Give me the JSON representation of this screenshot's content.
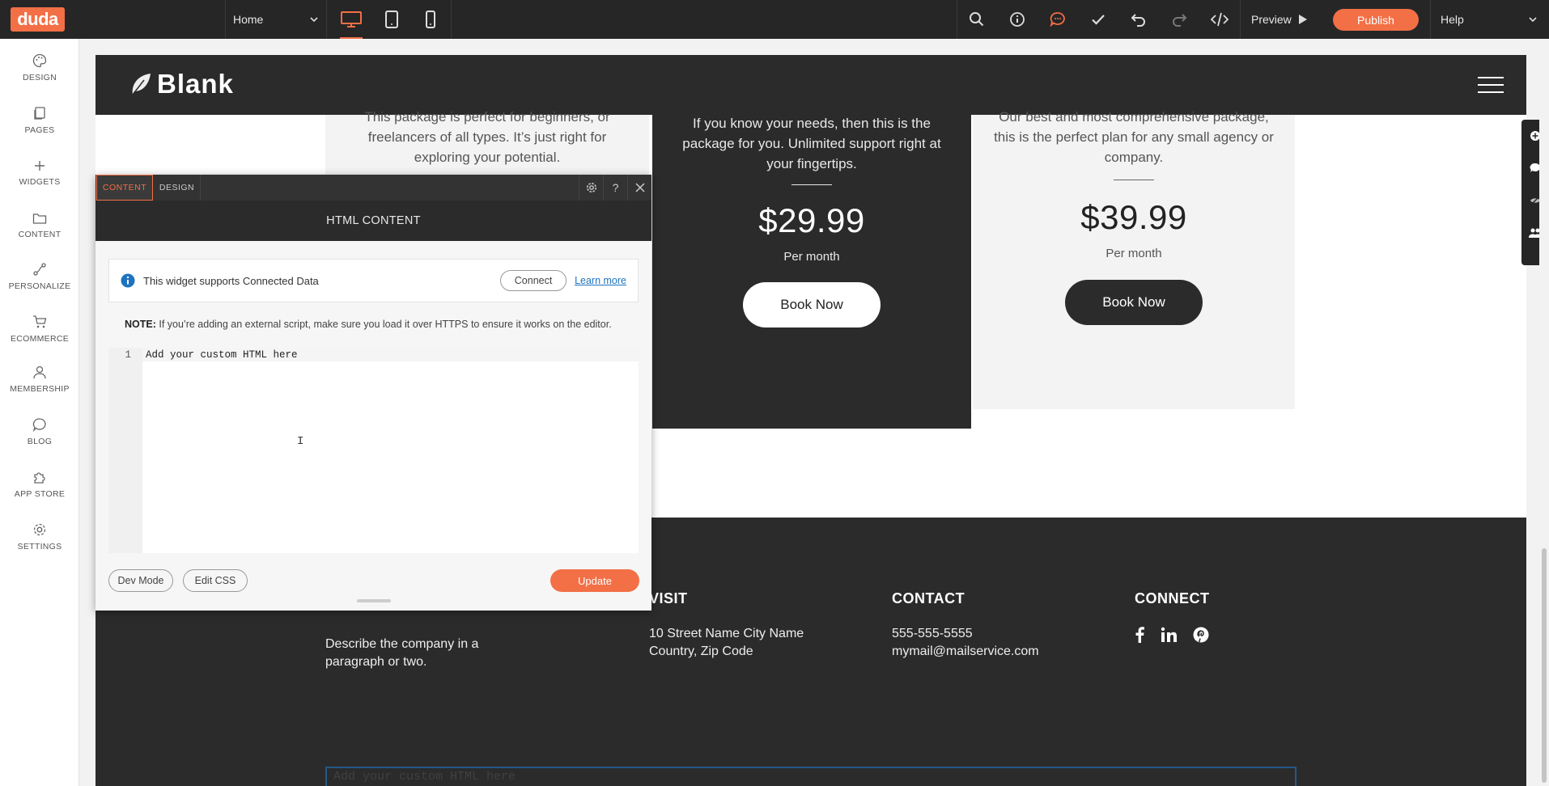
{
  "topbar": {
    "logo": "duda",
    "page_select": "Home",
    "preview": "Preview",
    "publish": "Publish",
    "help": "Help"
  },
  "sidebar": {
    "items": [
      {
        "label": "DESIGN",
        "icon": "palette-icon"
      },
      {
        "label": "PAGES",
        "icon": "pages-icon"
      },
      {
        "label": "WIDGETS",
        "icon": "plus-icon"
      },
      {
        "label": "CONTENT",
        "icon": "folder-icon"
      },
      {
        "label": "PERSONALIZE",
        "icon": "personalize-icon"
      },
      {
        "label": "ECOMMERCE",
        "icon": "cart-icon"
      },
      {
        "label": "MEMBERSHIP",
        "icon": "member-icon"
      },
      {
        "label": "BLOG",
        "icon": "chat-icon"
      },
      {
        "label": "APP STORE",
        "icon": "puzzle-icon"
      },
      {
        "label": "SETTINGS",
        "icon": "gear-icon"
      }
    ]
  },
  "site": {
    "brand": "Blank",
    "plans": [
      {
        "desc": "This package is perfect for beginners, or freelancers of all types. It’s just right for exploring your potential."
      },
      {
        "desc": "If you know your needs, then this is the package for you. Unlimited support right at your fingertips.",
        "price": "$29.99",
        "per": "Per month",
        "button": "Book Now"
      },
      {
        "desc": "Our best and most comprehensive package, this is the perfect plan for any small agency or company.",
        "price": "$39.99",
        "per": "Per month",
        "button": "Book Now"
      }
    ],
    "footer": {
      "about": "Describe the company in a paragraph or two.",
      "visit_head": "VISIT",
      "visit_line1": "10 Street Name City Name",
      "visit_line2": "Country, Zip Code",
      "contact_head": "CONTACT",
      "phone": "555-555-5555",
      "email": "mymail@mailservice.com",
      "connect_head": "CONNECT"
    },
    "html_placeholder": "Add your custom HTML here"
  },
  "panel": {
    "tab_content": "CONTENT",
    "tab_design": "DESIGN",
    "title": "HTML CONTENT",
    "info_text": "This widget supports Connected Data",
    "connect": "Connect",
    "learn_more": "Learn more",
    "note_label": "NOTE:",
    "note_text": " If you’re adding an external script, make sure you load it over HTTPS to ensure it works on the editor.",
    "line_number": "1",
    "code": "Add your custom HTML here",
    "dev_mode": "Dev Mode",
    "edit_css": "Edit CSS",
    "update": "Update"
  },
  "colors": {
    "accent": "#f36f46",
    "dark": "#2b2b2b",
    "link": "#1e73be"
  }
}
